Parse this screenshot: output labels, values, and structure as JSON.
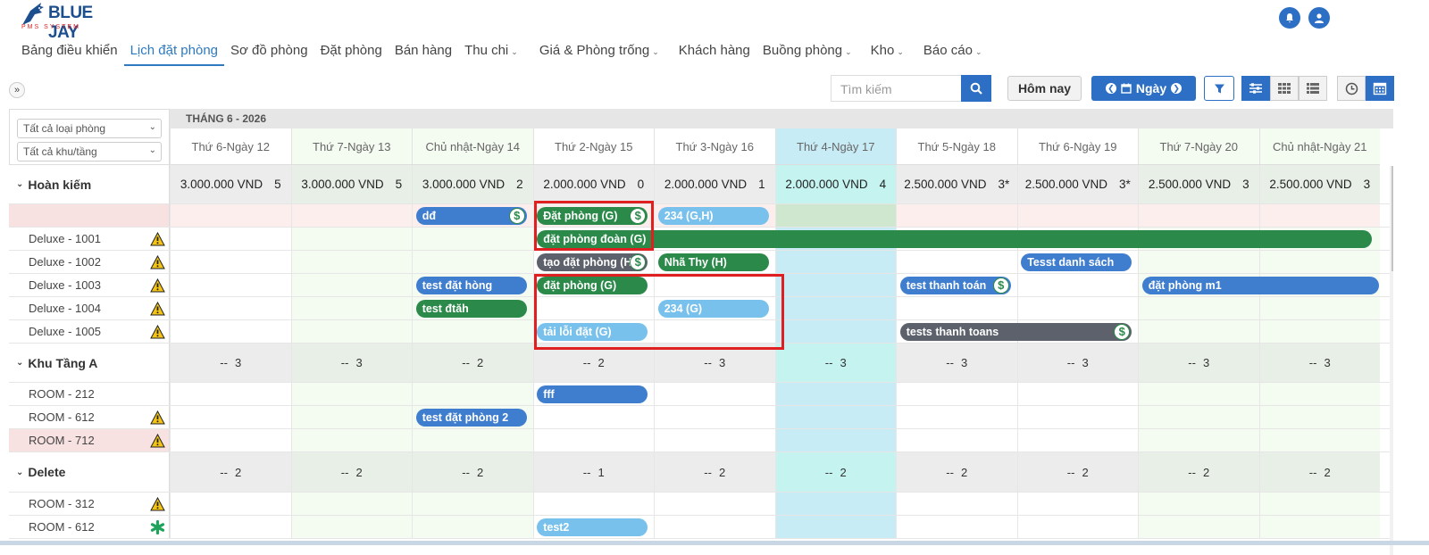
{
  "brand": {
    "name": "BLUE JAY",
    "sub": "PMS SYSTEM"
  },
  "nav": [
    {
      "label": "Bảng điều khiển",
      "active": false,
      "dropdown": false
    },
    {
      "label": "Lịch đặt phòng",
      "active": true,
      "dropdown": false
    },
    {
      "label": "Sơ đồ phòng",
      "active": false,
      "dropdown": false
    },
    {
      "label": "Đặt phòng",
      "active": false,
      "dropdown": false
    },
    {
      "label": "Bán hàng",
      "active": false,
      "dropdown": false
    },
    {
      "label": "Thu chi",
      "active": false,
      "dropdown": true
    },
    {
      "label": "Giá & Phòng trống",
      "active": false,
      "dropdown": true
    },
    {
      "label": "Khách hàng",
      "active": false,
      "dropdown": false
    },
    {
      "label": "Buồng phòng",
      "active": false,
      "dropdown": true
    },
    {
      "label": "Kho",
      "active": false,
      "dropdown": true
    },
    {
      "label": "Báo cáo",
      "active": false,
      "dropdown": true
    }
  ],
  "toolbar": {
    "search_placeholder": "Tìm kiếm",
    "today": "Hôm nay",
    "view": "Ngày"
  },
  "filters": {
    "room_type": "Tất cả loại phòng",
    "area": "Tất cả khu/tầng"
  },
  "month": "THÁNG 6 - 2026",
  "days": [
    {
      "dow": "Thứ 6",
      "day": "Ngày 12"
    },
    {
      "dow": "Thứ 7",
      "day": "Ngày 13"
    },
    {
      "dow": "Chủ nhật",
      "day": "Ngày 14"
    },
    {
      "dow": "Thứ 2",
      "day": "Ngày 15"
    },
    {
      "dow": "Thứ 3",
      "day": "Ngày 16"
    },
    {
      "dow": "Thứ 4",
      "day": "Ngày 17"
    },
    {
      "dow": "Thứ 5",
      "day": "Ngày 18"
    },
    {
      "dow": "Thứ 6",
      "day": "Ngày 19"
    },
    {
      "dow": "Thứ 7",
      "day": "Ngày 20"
    },
    {
      "dow": "Chủ nhật",
      "day": "Ngày 21"
    }
  ],
  "groups": [
    {
      "name": "Hoàn kiếm",
      "cells": [
        {
          "price": "3.000.000 VND",
          "avail": "5"
        },
        {
          "price": "3.000.000 VND",
          "avail": "5"
        },
        {
          "price": "3.000.000 VND",
          "avail": "2"
        },
        {
          "price": "2.000.000 VND",
          "avail": "0"
        },
        {
          "price": "2.000.000 VND",
          "avail": "1"
        },
        {
          "price": "2.000.000 VND",
          "avail": "4"
        },
        {
          "price": "2.500.000 VND",
          "avail": "3*"
        },
        {
          "price": "2.500.000 VND",
          "avail": "3*"
        },
        {
          "price": "2.500.000 VND",
          "avail": "3"
        },
        {
          "price": "2.500.000 VND",
          "avail": "3"
        }
      ],
      "rooms": [
        "",
        "Deluxe - 1001",
        "Deluxe - 1002",
        "Deluxe - 1003",
        "Deluxe - 1004",
        "Deluxe - 1005"
      ]
    },
    {
      "name": "Khu Tầng A",
      "cells": [
        {
          "price": "--",
          "avail": "3"
        },
        {
          "price": "--",
          "avail": "3"
        },
        {
          "price": "--",
          "avail": "2"
        },
        {
          "price": "--",
          "avail": "2"
        },
        {
          "price": "--",
          "avail": "3"
        },
        {
          "price": "--",
          "avail": "3"
        },
        {
          "price": "--",
          "avail": "3"
        },
        {
          "price": "--",
          "avail": "3"
        },
        {
          "price": "--",
          "avail": "3"
        },
        {
          "price": "--",
          "avail": "3"
        }
      ],
      "rooms": [
        "ROOM - 212",
        "ROOM - 612",
        "ROOM - 712"
      ]
    },
    {
      "name": "Delete",
      "cells": [
        {
          "price": "--",
          "avail": "2"
        },
        {
          "price": "--",
          "avail": "2"
        },
        {
          "price": "--",
          "avail": "2"
        },
        {
          "price": "--",
          "avail": "1"
        },
        {
          "price": "--",
          "avail": "2"
        },
        {
          "price": "--",
          "avail": "2"
        },
        {
          "price": "--",
          "avail": "2"
        },
        {
          "price": "--",
          "avail": "2"
        },
        {
          "price": "--",
          "avail": "2"
        },
        {
          "price": "--",
          "avail": "2"
        }
      ],
      "rooms": [
        "ROOM - 312",
        "ROOM - 612"
      ]
    }
  ],
  "bookings": [
    {
      "label": "dđ",
      "color": "blue",
      "payment_icon": true
    },
    {
      "label": "Đặt phòng (G)",
      "color": "green",
      "payment_icon": true
    },
    {
      "label": "234 (G,H)",
      "color": "light-blue",
      "payment_icon": false
    },
    {
      "label": "đặt phòng đoàn (G)",
      "color": "green",
      "payment_icon": false
    },
    {
      "label": "tạo đặt phòng (H)",
      "color": "dark-gray",
      "payment_icon": true
    },
    {
      "label": "Nhã Thy (H)",
      "color": "green",
      "payment_icon": false
    },
    {
      "label": "Tesst danh sách",
      "color": "blue",
      "payment_icon": false
    },
    {
      "label": "test đặt hòng",
      "color": "blue",
      "payment_icon": false
    },
    {
      "label": "đặt phòng (G)",
      "color": "green",
      "payment_icon": false
    },
    {
      "label": "test thanh toán",
      "color": "blue",
      "payment_icon": true
    },
    {
      "label": "đặt phòng m1",
      "color": "blue",
      "payment_icon": false
    },
    {
      "label": "test đtăh",
      "color": "green",
      "payment_icon": false
    },
    {
      "label": "234 (G)",
      "color": "light-blue",
      "payment_icon": false
    },
    {
      "label": "tải lỗi đặt (G)",
      "color": "light-blue",
      "payment_icon": false
    },
    {
      "label": "tests thanh toans",
      "color": "dark-gray",
      "payment_icon": true
    },
    {
      "label": "fff",
      "color": "blue",
      "payment_icon": false
    },
    {
      "label": "test đặt phòng 2",
      "color": "blue",
      "payment_icon": false
    },
    {
      "label": "test2",
      "color": "light-blue",
      "payment_icon": false
    }
  ]
}
